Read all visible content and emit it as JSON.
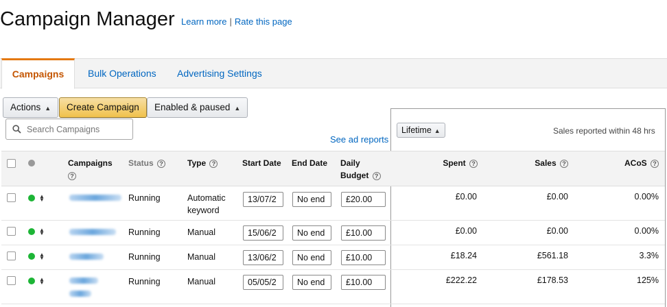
{
  "page": {
    "title": "Campaign Manager",
    "learn_more": "Learn more",
    "separator": "|",
    "rate_page": "Rate this page"
  },
  "tabs": [
    {
      "label": "Campaigns",
      "active": true
    },
    {
      "label": "Bulk Operations",
      "active": false
    },
    {
      "label": "Advertising Settings",
      "active": false
    }
  ],
  "toolbar": {
    "actions_label": "Actions",
    "create_label": "Create Campaign",
    "filter_label": "Enabled & paused",
    "search_placeholder": "Search Campaigns",
    "see_reports": "See ad reports"
  },
  "metrics": {
    "range_label": "Lifetime",
    "sales_note": "Sales reported within 48 hrs"
  },
  "table": {
    "headers": {
      "campaigns": "Campaigns",
      "status": "Status",
      "type": "Type",
      "start_date": "Start Date",
      "end_date": "End Date",
      "daily_budget": "Daily Budget",
      "spent": "Spent",
      "sales": "Sales",
      "acos": "ACoS"
    },
    "help_glyph": "?",
    "rows": [
      {
        "status": "Running",
        "type": "Automatic keyword",
        "start_date": "13/07/2",
        "end_date": "No end",
        "budget": "£20.00",
        "spent": "£0.00",
        "sales": "£0.00",
        "acos": "0.00%"
      },
      {
        "status": "Running",
        "type": "Manual",
        "start_date": "15/06/2",
        "end_date": "No end",
        "budget": "£10.00",
        "spent": "£0.00",
        "sales": "£0.00",
        "acos": "0.00%"
      },
      {
        "status": "Running",
        "type": "Manual",
        "start_date": "13/06/2",
        "end_date": "No end",
        "budget": "£10.00",
        "spent": "£18.24",
        "sales": "£561.18",
        "acos": "3.3%"
      },
      {
        "status": "Running",
        "type": "Manual",
        "start_date": "05/05/2",
        "end_date": "No end",
        "budget": "£10.00",
        "spent": "£222.22",
        "sales": "£178.53",
        "acos": "125%"
      }
    ]
  },
  "colors": {
    "accent_orange": "#c45500",
    "link_blue": "#0066c0",
    "status_green": "#1db536",
    "primary_button": "#f0c14b"
  }
}
